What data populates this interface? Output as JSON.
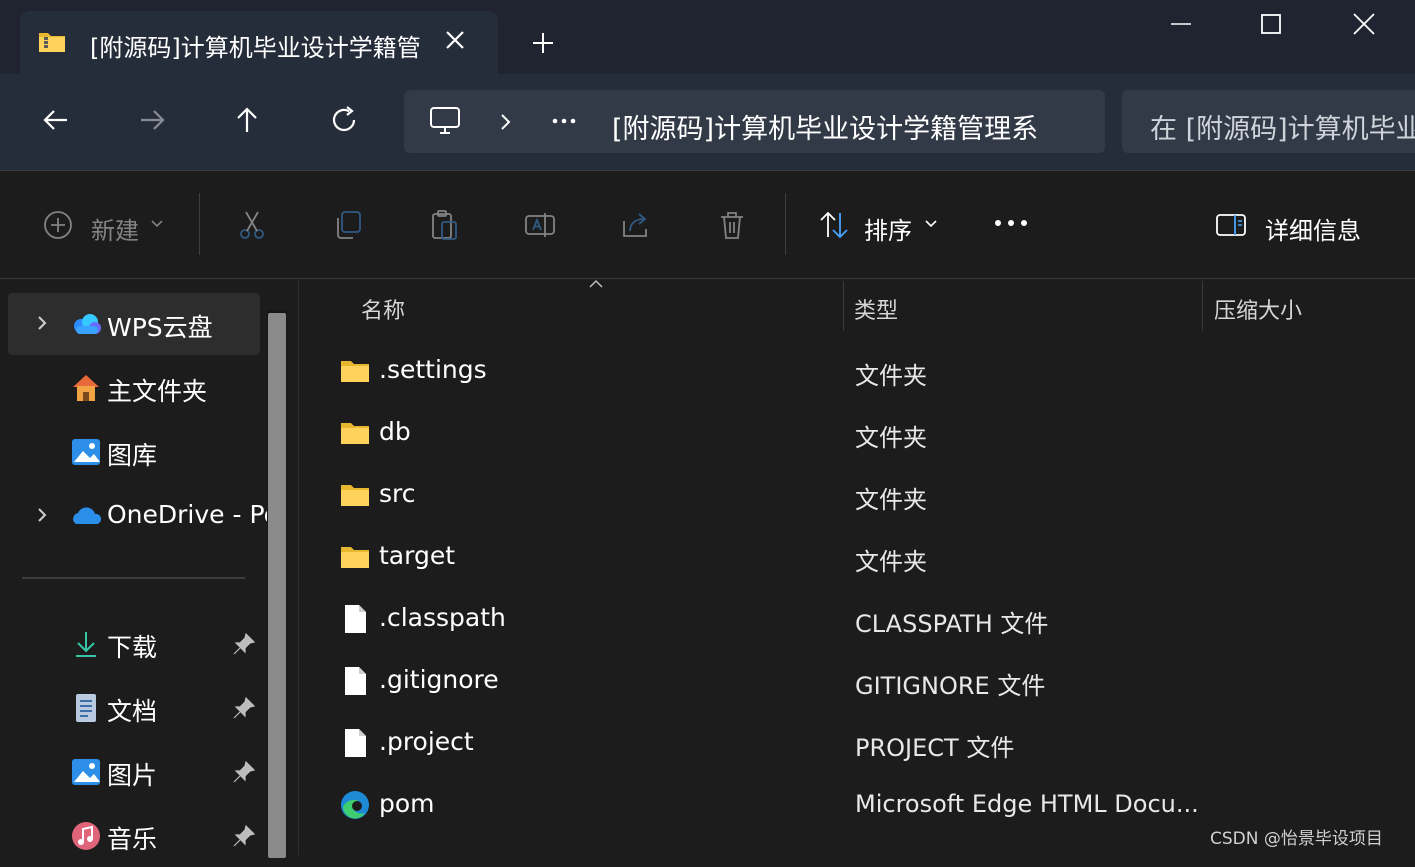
{
  "colors": {
    "accent": "#4aa3ff",
    "folder": "#ffc83d",
    "bg": "#1c1c1c",
    "titlebar": "#1f2430"
  },
  "tab": {
    "title": "[附源码]计算机毕业设计学籍管",
    "icon": "folder-zip-icon"
  },
  "address_bar": {
    "path_text": "[附源码]计算机毕业设计学籍管理系"
  },
  "search": {
    "placeholder": "在 [附源码]计算机毕业"
  },
  "toolbar": {
    "new_label": "新建",
    "sort_label": "排序",
    "details_label": "详细信息"
  },
  "sidebar": {
    "items": [
      {
        "label": "WPS云盘",
        "icon": "wps-cloud-icon"
      },
      {
        "label": "主文件夹",
        "icon": "home-icon"
      },
      {
        "label": "图库",
        "icon": "gallery-icon"
      },
      {
        "label": "OneDrive - Pe",
        "icon": "onedrive-icon"
      },
      {
        "label": "下载",
        "icon": "download-icon"
      },
      {
        "label": "文档",
        "icon": "documents-icon"
      },
      {
        "label": "图片",
        "icon": "pictures-icon"
      },
      {
        "label": "音乐",
        "icon": "music-icon"
      }
    ]
  },
  "columns": {
    "name": "名称",
    "type": "类型",
    "size": "压缩大小"
  },
  "files": [
    {
      "name": ".settings",
      "type": "文件夹",
      "icon": "folder-icon"
    },
    {
      "name": "db",
      "type": "文件夹",
      "icon": "folder-icon"
    },
    {
      "name": "src",
      "type": "文件夹",
      "icon": "folder-icon"
    },
    {
      "name": "target",
      "type": "文件夹",
      "icon": "folder-icon"
    },
    {
      "name": ".classpath",
      "type": "CLASSPATH 文件",
      "icon": "file-icon"
    },
    {
      "name": ".gitignore",
      "type": "GITIGNORE 文件",
      "icon": "file-icon"
    },
    {
      "name": ".project",
      "type": "PROJECT 文件",
      "icon": "file-icon"
    },
    {
      "name": "pom",
      "type": "Microsoft Edge HTML Docu...",
      "icon": "edge-icon"
    }
  ],
  "watermark": "CSDN @怡景毕设项目"
}
